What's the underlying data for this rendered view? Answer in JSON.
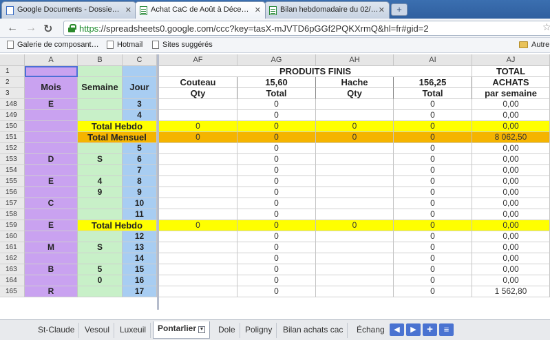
{
  "browser": {
    "tabs": [
      {
        "title": "Google Documents - Dossie…",
        "icon": "docs-icon"
      },
      {
        "title": "Achat CaC de Août à Déce…",
        "icon": "spreadsheet-icon",
        "active": true
      },
      {
        "title": "Bilan hebdomadaire du 02/…",
        "icon": "spreadsheet-icon"
      }
    ],
    "url_scheme": "https",
    "url_rest": "://spreadsheets0.google.com/ccc?key=tasX-mJVTD6pGGf2PQKXrmQ&hl=fr#gid=2",
    "bookmarks": [
      "Galerie de composant…",
      "Hotmail",
      "Sites suggérés"
    ],
    "other_bookmarks": "Autre"
  },
  "columns": [
    "A",
    "B",
    "C",
    "AF",
    "AG",
    "AH",
    "AI",
    "AJ"
  ],
  "header_rows": {
    "r1": {
      "num": "1",
      "produits": "PRODUITS FINIS",
      "total": "TOTAL"
    },
    "r2": {
      "num": "2",
      "mois": "Mois",
      "semaine": "Semaine",
      "jour": "Jour",
      "af": "Couteau",
      "ag": "15,60",
      "ah": "Hache",
      "ai": "156,25",
      "aj": "ACHATS"
    },
    "r3": {
      "num": "3",
      "af": "Qty",
      "ag": "Total",
      "ah": "Qty",
      "ai": "Total",
      "aj": "par semaine"
    }
  },
  "rows": [
    {
      "num": "148",
      "a": "E",
      "b": "",
      "c": "3",
      "af": "",
      "ag": "0",
      "ah": "",
      "ai": "0",
      "aj": "0,00"
    },
    {
      "num": "149",
      "a": "",
      "b": "",
      "c": "4",
      "af": "",
      "ag": "0",
      "ah": "",
      "ai": "0",
      "aj": "0,00"
    },
    {
      "num": "150",
      "a": "",
      "b": "Total Hebdo",
      "c": "",
      "af": "0",
      "ag": "0",
      "ah": "0",
      "ai": "0",
      "aj": "0,00",
      "kind": "hebdo"
    },
    {
      "num": "151",
      "a": "",
      "b": "Total Mensuel",
      "c": "",
      "af": "0",
      "ag": "0",
      "ah": "0",
      "ai": "0",
      "aj": "8 062,50",
      "kind": "mensuel"
    },
    {
      "num": "152",
      "a": "",
      "b": "",
      "c": "5",
      "af": "",
      "ag": "0",
      "ah": "",
      "ai": "0",
      "aj": "0,00"
    },
    {
      "num": "153",
      "a": "D",
      "b": "S",
      "c": "6",
      "af": "",
      "ag": "0",
      "ah": "",
      "ai": "0",
      "aj": "0,00"
    },
    {
      "num": "154",
      "a": "",
      "b": "",
      "c": "7",
      "af": "",
      "ag": "0",
      "ah": "",
      "ai": "0",
      "aj": "0,00"
    },
    {
      "num": "155",
      "a": "E",
      "b": "4",
      "c": "8",
      "af": "",
      "ag": "0",
      "ah": "",
      "ai": "0",
      "aj": "0,00"
    },
    {
      "num": "156",
      "a": "",
      "b": "9",
      "c": "9",
      "af": "",
      "ag": "0",
      "ah": "",
      "ai": "0",
      "aj": "0,00"
    },
    {
      "num": "157",
      "a": "C",
      "b": "",
      "c": "10",
      "af": "",
      "ag": "0",
      "ah": "",
      "ai": "0",
      "aj": "0,00"
    },
    {
      "num": "158",
      "a": "",
      "b": "",
      "c": "11",
      "af": "",
      "ag": "0",
      "ah": "",
      "ai": "0",
      "aj": "0,00"
    },
    {
      "num": "159",
      "a": "E",
      "b": "Total Hebdo",
      "c": "",
      "af": "0",
      "ag": "0",
      "ah": "0",
      "ai": "0",
      "aj": "0,00",
      "kind": "hebdo"
    },
    {
      "num": "160",
      "a": "",
      "b": "",
      "c": "12",
      "af": "",
      "ag": "0",
      "ah": "",
      "ai": "0",
      "aj": "0,00"
    },
    {
      "num": "161",
      "a": "M",
      "b": "S",
      "c": "13",
      "af": "",
      "ag": "0",
      "ah": "",
      "ai": "0",
      "aj": "0,00"
    },
    {
      "num": "162",
      "a": "",
      "b": "",
      "c": "14",
      "af": "",
      "ag": "0",
      "ah": "",
      "ai": "0",
      "aj": "0,00"
    },
    {
      "num": "163",
      "a": "B",
      "b": "5",
      "c": "15",
      "af": "",
      "ag": "0",
      "ah": "",
      "ai": "0",
      "aj": "0,00"
    },
    {
      "num": "164",
      "a": "",
      "b": "0",
      "c": "16",
      "af": "",
      "ag": "0",
      "ah": "",
      "ai": "0",
      "aj": "0,00"
    },
    {
      "num": "165",
      "a": "R",
      "b": "",
      "c": "17",
      "af": "",
      "ag": "0",
      "ah": "",
      "ai": "0",
      "aj": "1 562,80"
    }
  ],
  "sheet_tabs": [
    "St-Claude",
    "Vesoul",
    "Luxeuil",
    "Pontarlier",
    "Dole",
    "Poligny",
    "Bilan achats cac",
    "Échang"
  ],
  "active_sheet": "Pontarlier",
  "colors": {
    "purple": "#c9a2f0",
    "green": "#c8f0c8",
    "blue": "#a8cdf2",
    "yellow": "#ffff00",
    "orange": "#f5b400"
  }
}
